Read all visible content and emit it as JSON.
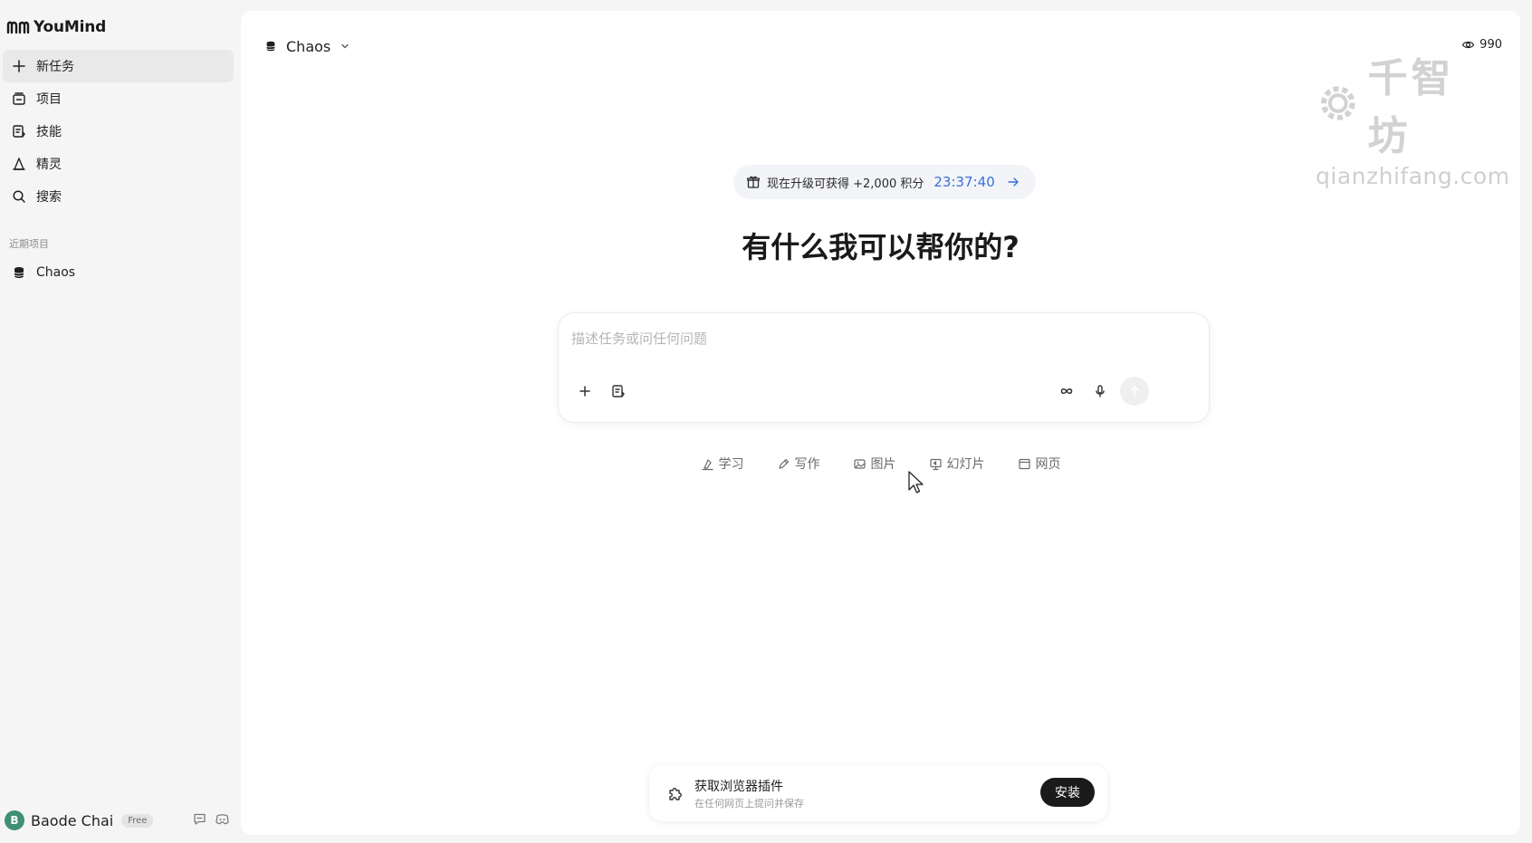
{
  "app": {
    "brand_name": "YouMind"
  },
  "sidebar": {
    "nav": [
      {
        "label": "新任务",
        "icon": "plus-icon"
      },
      {
        "label": "项目",
        "icon": "project-box-icon"
      },
      {
        "label": "技能",
        "icon": "skill-icon"
      },
      {
        "label": "精灵",
        "icon": "spirit-hat-icon"
      },
      {
        "label": "搜索",
        "icon": "search-icon"
      }
    ],
    "recent_label": "近期项目",
    "recent": [
      {
        "label": "Chaos",
        "icon": "database-icon"
      }
    ],
    "user": {
      "initial": "B",
      "name": "Baode Chai",
      "plan": "Free"
    }
  },
  "header": {
    "project_name": "Chaos",
    "credits": "990"
  },
  "watermark": {
    "chars": "千智坊",
    "url": "qianzhifang.com"
  },
  "promo": {
    "text": "现在升级可获得 +2,000 积分",
    "timer": "23:37:40"
  },
  "main": {
    "heading": "有什么我可以帮你的?",
    "input_placeholder": "描述任务或问任何问题",
    "input_value": ""
  },
  "chips": [
    {
      "label": "学习",
      "icon": "study-icon"
    },
    {
      "label": "写作",
      "icon": "pen-icon"
    },
    {
      "label": "图片",
      "icon": "image-icon"
    },
    {
      "label": "幻灯片",
      "icon": "presentation-icon"
    },
    {
      "label": "网页",
      "icon": "webpage-icon"
    }
  ],
  "extension": {
    "title": "获取浏览器插件",
    "subtitle": "在任何网页上提问并保存",
    "button": "安装"
  },
  "colors": {
    "accent_blue": "#3d6fd8",
    "avatar_green": "#3f8f75",
    "install_button": "#1a1a1a"
  }
}
